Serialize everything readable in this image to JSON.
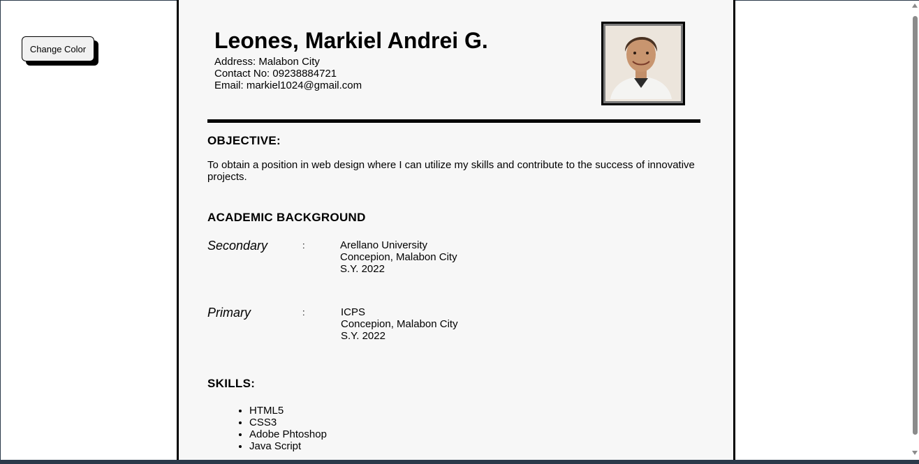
{
  "controls": {
    "change_color_label": "Change Color"
  },
  "header": {
    "name": "Leones, Markiel Andrei G.",
    "address": "Address: Malabon City",
    "contact": "Contact No: 09238884721",
    "email": "Email: markiel1024@gmail.com"
  },
  "objective": {
    "heading": "OBJECTIVE:",
    "text": "To obtain a position in web design where I can utilize my skills and contribute to the success of innovative projects."
  },
  "academic": {
    "heading": "ACADEMIC BACKGROUND",
    "entries": [
      {
        "level": "Secondary",
        "colon": ":",
        "school": "Arellano University",
        "location": "Concepion, Malabon City",
        "year": "S.Y. 2022"
      },
      {
        "level": "Primary",
        "colon": ":",
        "school": "ICPS",
        "location": "Concepion, Malabon City",
        "year": "S.Y. 2022"
      }
    ]
  },
  "skills": {
    "heading": "SKILLS:",
    "items": [
      "HTML5",
      "CSS3",
      "Adobe Phtoshop",
      "Java Script"
    ]
  },
  "colors": {
    "paper": "#f7f7f7",
    "page": "#ffffff",
    "border": "#000000",
    "button": "#f1f1f1"
  },
  "icons": {
    "photo": "profile-photo",
    "scroll_up": "scroll-up-arrow-icon",
    "scroll_down": "scroll-down-arrow-icon"
  }
}
